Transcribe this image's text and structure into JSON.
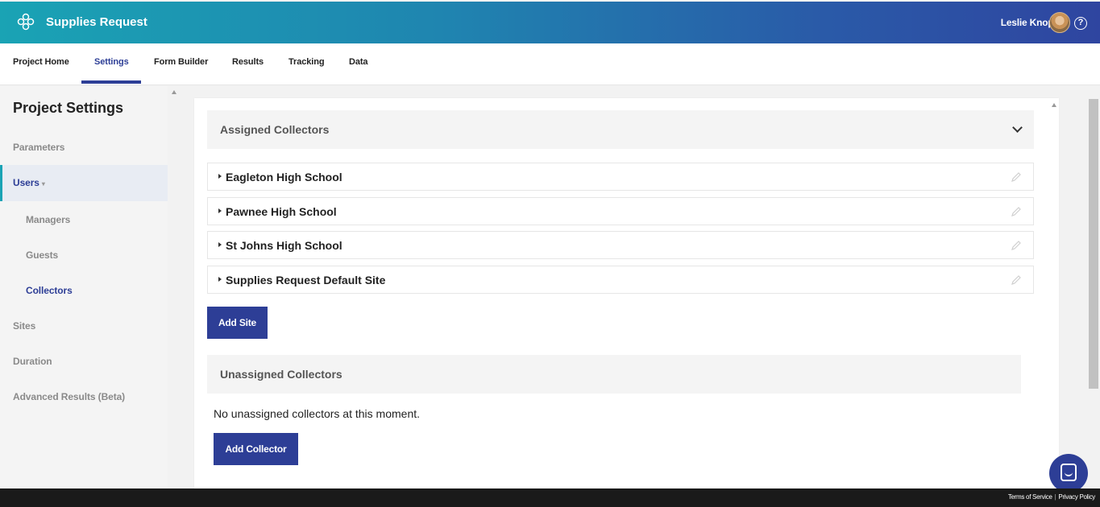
{
  "header": {
    "app_title": "Supplies Request",
    "user_name": "Leslie Knope",
    "help_label": "?"
  },
  "tabs": [
    {
      "label": "Project Home"
    },
    {
      "label": "Settings",
      "active": true
    },
    {
      "label": "Form Builder"
    },
    {
      "label": "Results"
    },
    {
      "label": "Tracking"
    },
    {
      "label": "Data"
    }
  ],
  "sidebar": {
    "title": "Project Settings",
    "items": [
      {
        "label": "Parameters"
      },
      {
        "label": "Users",
        "expanded": true
      },
      {
        "label": "Managers"
      },
      {
        "label": "Guests"
      },
      {
        "label": "Collectors",
        "selected": true
      },
      {
        "label": "Sites"
      },
      {
        "label": "Duration"
      },
      {
        "label": "Advanced Results (Beta)"
      }
    ]
  },
  "assigned": {
    "title": "Assigned Collectors",
    "sites": [
      {
        "name": "Eagleton High School"
      },
      {
        "name": "Pawnee High School"
      },
      {
        "name": "St Johns High School"
      },
      {
        "name": "Supplies Request Default Site"
      }
    ],
    "add_site_label": "Add Site"
  },
  "unassigned": {
    "title": "Unassigned Collectors",
    "empty_text": "No unassigned collectors at this moment.",
    "add_collector_label": "Add Collector"
  },
  "footer": {
    "terms": "Terms of Service",
    "privacy": "Privacy Policy"
  },
  "colors": {
    "primary": "#2d3e96",
    "accent": "#1aa3b4"
  }
}
